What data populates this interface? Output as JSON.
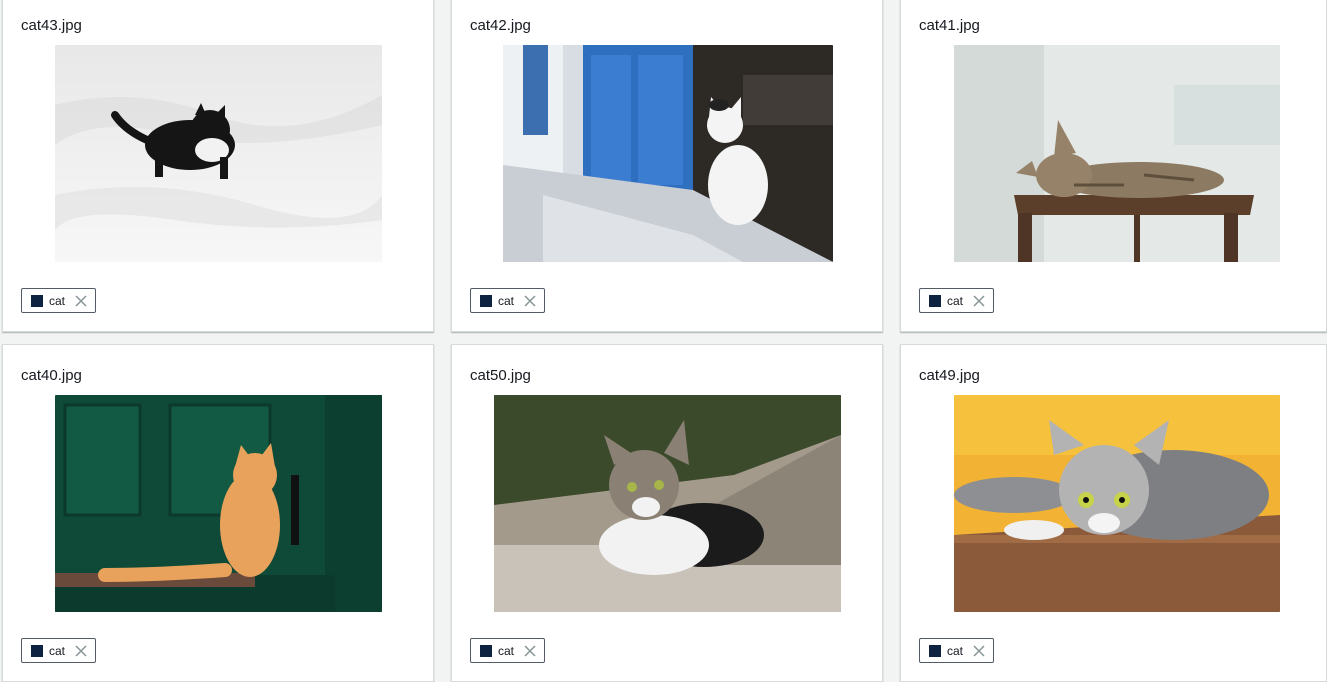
{
  "accent_colors": {
    "label_swatch": "#0d2340",
    "chip_border": "#545b64",
    "close_icon": "#879596"
  },
  "cards": [
    {
      "filename": "cat43.jpg",
      "label": "cat",
      "image": "black-and-white-cat-in-snow"
    },
    {
      "filename": "cat42.jpg",
      "label": "cat",
      "image": "white-cat-by-blue-door"
    },
    {
      "filename": "cat41.jpg",
      "label": "cat",
      "image": "tabby-cat-on-wooden-stool"
    },
    {
      "filename": "cat40.jpg",
      "label": "cat",
      "image": "orange-kitten-by-green-door"
    },
    {
      "filename": "cat50.jpg",
      "label": "cat",
      "image": "tabby-white-cat-lying-on-ledge"
    },
    {
      "filename": "cat49.jpg",
      "label": "cat",
      "image": "tabby-kitten-orange-background"
    }
  ]
}
